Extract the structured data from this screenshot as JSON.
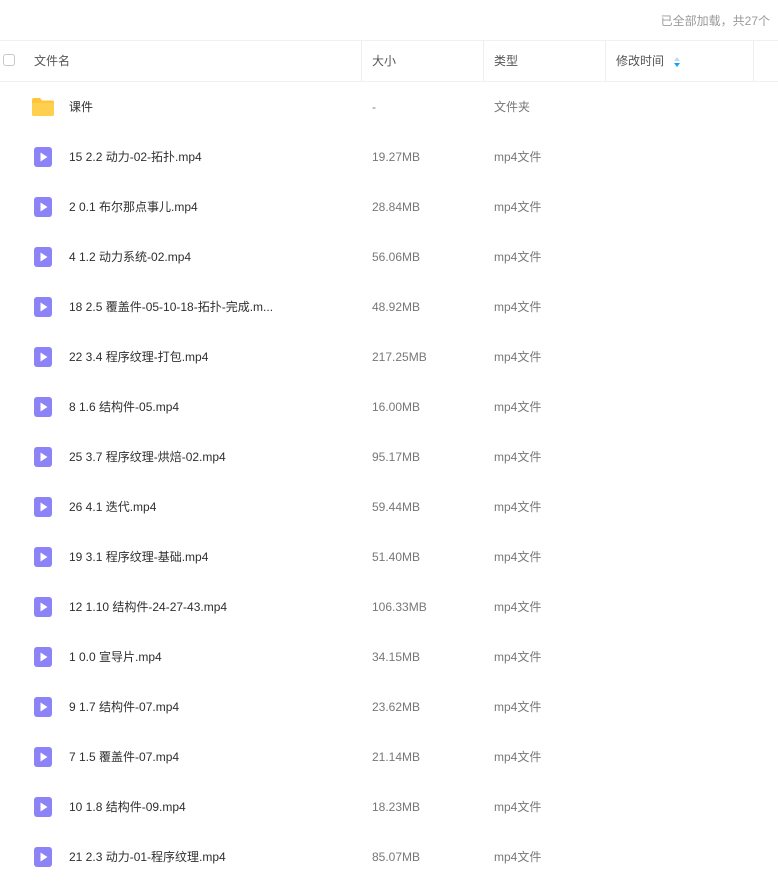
{
  "status": {
    "loaded_text": "已全部加载，共27个"
  },
  "header": {
    "name": "文件名",
    "size": "大小",
    "type": "类型",
    "modified": "修改时间"
  },
  "colors": {
    "folder": "#FFC63A",
    "video": "#8C83F7",
    "sort_active": "#06A7FF"
  },
  "files": [
    {
      "icon": "folder-icon",
      "name": "课件",
      "size": "-",
      "type": "文件夹"
    },
    {
      "icon": "video-icon",
      "name": "15 2.2 动力-02-拓扑.mp4",
      "size": "19.27MB",
      "type": "mp4文件"
    },
    {
      "icon": "video-icon",
      "name": "2 0.1 布尔那点事儿.mp4",
      "size": "28.84MB",
      "type": "mp4文件"
    },
    {
      "icon": "video-icon",
      "name": "4 1.2 动力系统-02.mp4",
      "size": "56.06MB",
      "type": "mp4文件"
    },
    {
      "icon": "video-icon",
      "name": "18 2.5 覆盖件-05-10-18-拓扑-完成.m...",
      "size": "48.92MB",
      "type": "mp4文件"
    },
    {
      "icon": "video-icon",
      "name": "22 3.4 程序纹理-打包.mp4",
      "size": "217.25MB",
      "type": "mp4文件"
    },
    {
      "icon": "video-icon",
      "name": "8 1.6 结构件-05.mp4",
      "size": "16.00MB",
      "type": "mp4文件"
    },
    {
      "icon": "video-icon",
      "name": "25 3.7 程序纹理-烘焙-02.mp4",
      "size": "95.17MB",
      "type": "mp4文件"
    },
    {
      "icon": "video-icon",
      "name": "26 4.1 迭代.mp4",
      "size": "59.44MB",
      "type": "mp4文件"
    },
    {
      "icon": "video-icon",
      "name": "19 3.1 程序纹理-基础.mp4",
      "size": "51.40MB",
      "type": "mp4文件"
    },
    {
      "icon": "video-icon",
      "name": "12 1.10 结构件-24-27-43.mp4",
      "size": "106.33MB",
      "type": "mp4文件"
    },
    {
      "icon": "video-icon",
      "name": "1 0.0 宣导片.mp4",
      "size": "34.15MB",
      "type": "mp4文件"
    },
    {
      "icon": "video-icon",
      "name": "9 1.7 结构件-07.mp4",
      "size": "23.62MB",
      "type": "mp4文件"
    },
    {
      "icon": "video-icon",
      "name": "7 1.5 覆盖件-07.mp4",
      "size": "21.14MB",
      "type": "mp4文件"
    },
    {
      "icon": "video-icon",
      "name": "10 1.8 结构件-09.mp4",
      "size": "18.23MB",
      "type": "mp4文件"
    },
    {
      "icon": "video-icon",
      "name": "21 2.3 动力-01-程序纹理.mp4",
      "size": "85.07MB",
      "type": "mp4文件"
    }
  ]
}
